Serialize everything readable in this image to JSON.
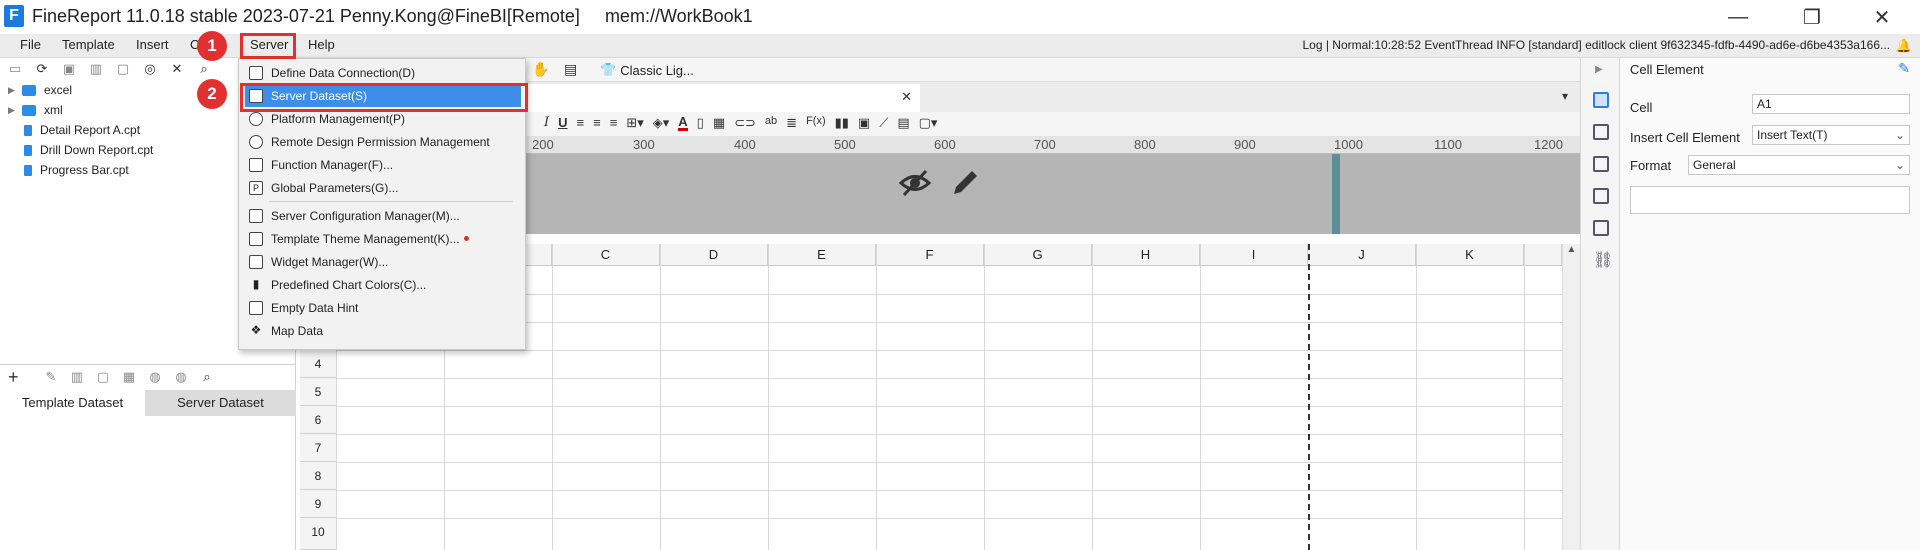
{
  "window": {
    "title": "FineReport 11.0.18 stable 2023-07-21 Penny.Kong@FineBI[Remote]     mem://WorkBook1",
    "logo_letter": "F",
    "controls": {
      "minimize": "—",
      "restore": "❐",
      "close": "✕"
    }
  },
  "menubar": {
    "items": [
      "File",
      "Template",
      "Insert",
      "C",
      "Server",
      "Help"
    ],
    "log": "Log | Normal:10:28:52 EventThread INFO [standard] editlock client 9f632345-fdfb-4490-ad6e-d6be4353a166..."
  },
  "template_tree": {
    "folders": [
      "excel",
      "xml"
    ],
    "files": [
      "Detail Report A.cpt",
      "Drill Down Report.cpt",
      "Progress Bar.cpt"
    ]
  },
  "dataset_panel": {
    "add_label": "+",
    "tabs": [
      "Template Dataset",
      "Server Dataset"
    ]
  },
  "editor": {
    "toolbar_label": "Classic Lig...",
    "tab_close": "✕",
    "ruler": [
      "200",
      "300",
      "400",
      "500",
      "600",
      "700",
      "800",
      "900",
      "1000",
      "1100",
      "1200"
    ],
    "columns": [
      "C",
      "D",
      "E",
      "F",
      "G",
      "H",
      "I",
      "J",
      "K"
    ],
    "rows": [
      "4",
      "5",
      "6",
      "7",
      "8",
      "9",
      "10"
    ]
  },
  "server_menu": {
    "items": [
      "Define Data Connection(D)",
      "Server Dataset(S)",
      "Platform Management(P)",
      "Remote Design Permission Management",
      "Function Manager(F)...",
      "Global Parameters(G)...",
      "Server Configuration Manager(M)...",
      "Template Theme Management(K)...",
      "Widget Manager(W)...",
      "Predefined Chart Colors(C)...",
      "Empty Data Hint",
      "Map Data"
    ],
    "highlighted_index": 1,
    "highlight_color": "#3d8ee8"
  },
  "callouts": {
    "step1": "1",
    "step2": "2"
  },
  "right_panel": {
    "title": "Cell Element",
    "cell_label": "Cell",
    "cell_value": "A1",
    "insert_label": "Insert Cell Element",
    "insert_value": "Insert Text(T)",
    "format_label": "Format",
    "format_value": "General"
  },
  "colors": {
    "accent": "#e03030",
    "brand": "#1a7ae0"
  }
}
